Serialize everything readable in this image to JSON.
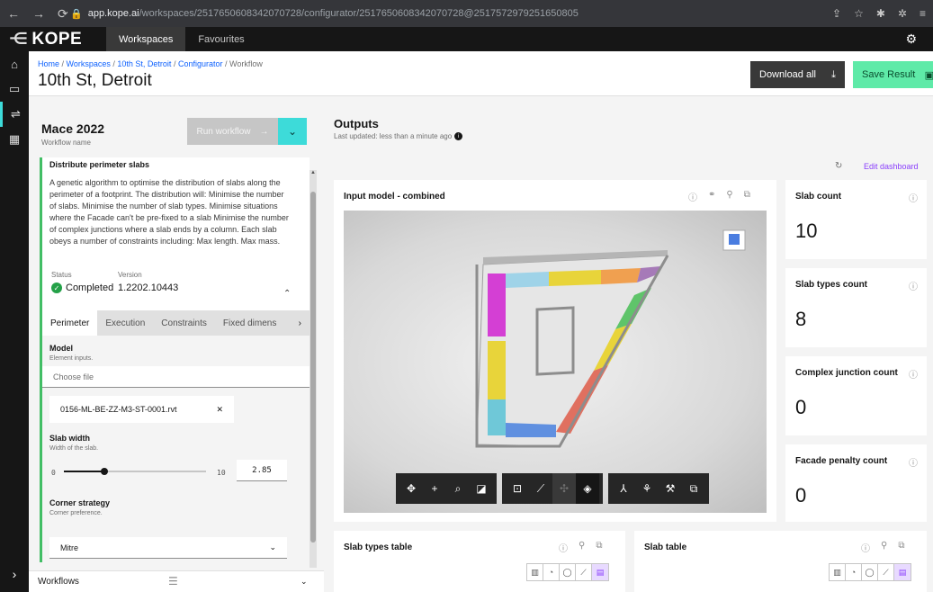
{
  "browser": {
    "url_host": "app.kope.ai",
    "url_path": "/workspaces/2517650608342070728/configurator/2517650608342070728@2517572979251650805"
  },
  "app": {
    "logo": "KOPE",
    "tabs": [
      "Workspaces",
      "Favourites"
    ]
  },
  "header": {
    "breadcrumb": [
      "Home",
      "Workspaces",
      "10th St, Detroit",
      "Configurator",
      "Workflow"
    ],
    "title": "10th St, Detroit",
    "download_label": "Download all",
    "save_label": "Save Result"
  },
  "workflow": {
    "name": "Mace 2022",
    "name_label": "Workflow name",
    "run_label": "Run workflow",
    "task_title": "Distribute perimeter slabs",
    "description": "A genetic algorithm to optimise the distribution of slabs along the perimeter of a footprint. The distribution will: Minimise the number of slabs. Minimise the number of slab types. Minimise situations where the Facade can't be pre-fixed to a slab Minimise the number of complex junctions where a slab ends by a column. Each slab obeys a number of constraints including: Max length. Max mass.",
    "status_label": "Status",
    "status_value": "Completed",
    "version_label": "Version",
    "version_value": "1.2202.10443",
    "tabs": [
      "Perimeter",
      "Execution",
      "Constraints",
      "Fixed dimens"
    ],
    "model_label": "Model",
    "model_hint": "Element inputs.",
    "file_placeholder": "Choose file",
    "file_name": "0156-ML-BE-ZZ-M3-ST-0001.rvt",
    "slab_width_label": "Slab width",
    "slab_width_hint": "Width of the slab.",
    "slider_min": "0",
    "slider_max": "10",
    "slider_value": "2.85",
    "slider_fraction": 0.285,
    "corner_label": "Corner strategy",
    "corner_hint": "Corner preference.",
    "corner_value": "Mitre",
    "workflows_label": "Workflows"
  },
  "outputs": {
    "title": "Outputs",
    "updated": "Last updated: less than a minute ago",
    "edit_dashboard": "Edit dashboard",
    "viewer_title": "Input model - combined",
    "kpis": [
      {
        "label": "Slab count",
        "value": "10"
      },
      {
        "label": "Slab types count",
        "value": "8"
      },
      {
        "label": "Complex junction count",
        "value": "0"
      },
      {
        "label": "Facade penalty count",
        "value": "0"
      }
    ],
    "tables": [
      "Slab types table",
      "Slab table"
    ]
  },
  "colors": {
    "accent": "#3ddbd9",
    "save": "#5feaa8",
    "status_ok": "#24a148",
    "edit_link": "#8a3ffc"
  }
}
